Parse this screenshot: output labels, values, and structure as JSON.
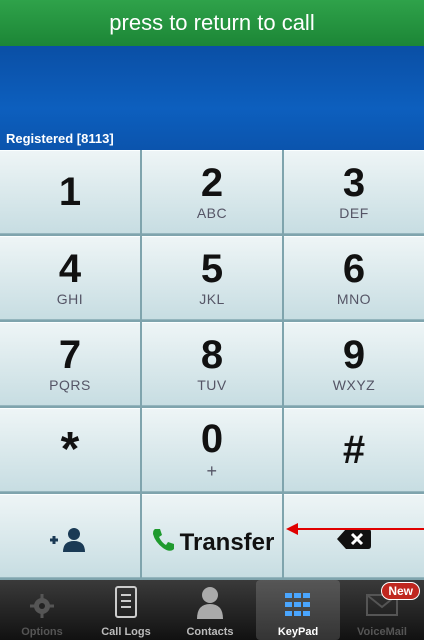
{
  "return_bar": {
    "label": "press to return to call"
  },
  "status": {
    "text": "Registered [8113]"
  },
  "keypad": {
    "keys": [
      {
        "digit": "1",
        "letters": ""
      },
      {
        "digit": "2",
        "letters": "ABC"
      },
      {
        "digit": "3",
        "letters": "DEF"
      },
      {
        "digit": "4",
        "letters": "GHI"
      },
      {
        "digit": "5",
        "letters": "JKL"
      },
      {
        "digit": "6",
        "letters": "MNO"
      },
      {
        "digit": "7",
        "letters": "PQRS"
      },
      {
        "digit": "8",
        "letters": "TUV"
      },
      {
        "digit": "9",
        "letters": "WXYZ"
      },
      {
        "digit": "*",
        "letters": ""
      },
      {
        "digit": "0",
        "letters": "+"
      },
      {
        "digit": "#",
        "letters": ""
      }
    ],
    "transfer_label": "Transfer"
  },
  "tabbar": {
    "tabs": [
      {
        "label": "Options",
        "icon": "gear-icon"
      },
      {
        "label": "Call Logs",
        "icon": "call-logs-icon"
      },
      {
        "label": "Contacts",
        "icon": "contact-icon"
      },
      {
        "label": "KeyPad",
        "icon": "keypad-icon",
        "active": true
      },
      {
        "label": "VoiceMail",
        "icon": "voicemail-icon",
        "badge": "New"
      }
    ]
  },
  "colors": {
    "return_bar": "#2fa24a",
    "display": "#0d5fbe",
    "arrow": "#e00000",
    "badge": "#c0271f"
  }
}
